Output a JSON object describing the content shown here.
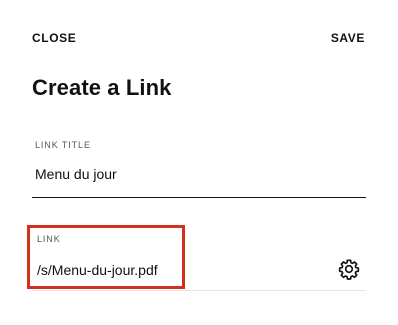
{
  "header": {
    "close_label": "CLOSE",
    "save_label": "SAVE"
  },
  "panel": {
    "title": "Create a Link"
  },
  "fields": {
    "link_title": {
      "label": "LINK TITLE",
      "value": "Menu du jour"
    },
    "link": {
      "label": "LINK",
      "value": "/s/Menu-du-jour.pdf"
    }
  },
  "icons": {
    "settings": "gear-icon"
  },
  "colors": {
    "highlight": "#d0301d",
    "text": "#111111"
  }
}
